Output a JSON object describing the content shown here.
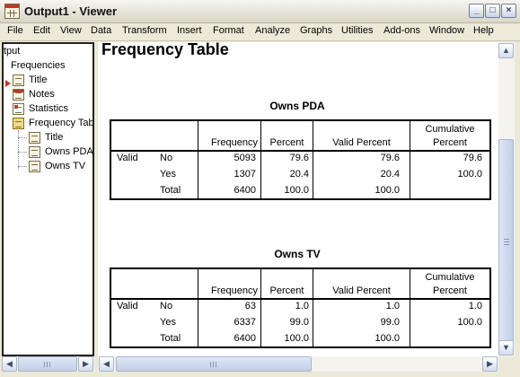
{
  "window": {
    "title": "Output1 - Viewer",
    "buttons": {
      "minimize": "_",
      "maximize": "□",
      "close": "×"
    }
  },
  "menu": [
    "File",
    "Edit",
    "View",
    "Data",
    "Transform",
    "Insert",
    "Format",
    "Analyze",
    "Graphs",
    "Utilities",
    "Add-ons",
    "Window",
    "Help"
  ],
  "outline": {
    "root": "tput",
    "items": [
      "Frequencies",
      "Title",
      "Notes",
      "Statistics",
      "Frequency Tab",
      "Title",
      "Owns PDA",
      "Owns TV"
    ]
  },
  "content": {
    "heading": "Frequency Table",
    "tables": [
      {
        "title": "Owns PDA",
        "headers": {
          "frequency": "Frequency",
          "percent": "Percent",
          "valid_percent": "Valid Percent",
          "cumulative_line1": "Cumulative",
          "cumulative_line2": "Percent"
        },
        "group": "Valid",
        "rows": [
          {
            "label": "No",
            "frequency": "5093",
            "percent": "79.6",
            "valid_percent": "79.6",
            "cumulative": "79.6"
          },
          {
            "label": "Yes",
            "frequency": "1307",
            "percent": "20.4",
            "valid_percent": "20.4",
            "cumulative": "100.0"
          },
          {
            "label": "Total",
            "frequency": "6400",
            "percent": "100.0",
            "valid_percent": "100.0",
            "cumulative": ""
          }
        ]
      },
      {
        "title": "Owns TV",
        "headers": {
          "frequency": "Frequency",
          "percent": "Percent",
          "valid_percent": "Valid Percent",
          "cumulative_line1": "Cumulative",
          "cumulative_line2": "Percent"
        },
        "group": "Valid",
        "rows": [
          {
            "label": "No",
            "frequency": "63",
            "percent": "1.0",
            "valid_percent": "1.0",
            "cumulative": "1.0"
          },
          {
            "label": "Yes",
            "frequency": "6337",
            "percent": "99.0",
            "valid_percent": "99.0",
            "cumulative": "100.0"
          },
          {
            "label": "Total",
            "frequency": "6400",
            "percent": "100.0",
            "valid_percent": "100.0",
            "cumulative": ""
          }
        ]
      }
    ]
  },
  "scrollbars": {
    "up": "▲",
    "down": "▼",
    "left": "◀",
    "right": "▶"
  }
}
